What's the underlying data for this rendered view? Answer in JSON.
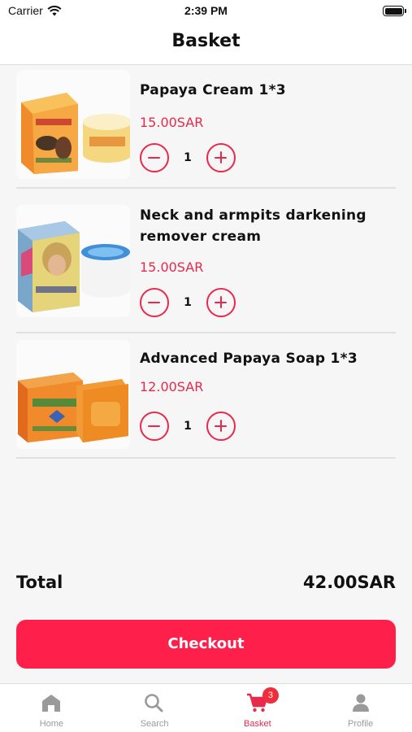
{
  "status_bar": {
    "carrier": "Carrier",
    "time": "2:39 PM"
  },
  "header": {
    "title": "Basket"
  },
  "cart": {
    "items": [
      {
        "name": "Papaya Cream 1*3",
        "price": "15.00SAR",
        "quantity": "1"
      },
      {
        "name": "Neck and armpits darkening remover cream",
        "price": "15.00SAR",
        "quantity": "1"
      },
      {
        "name": "Advanced Papaya Soap 1*3",
        "price": "12.00SAR",
        "quantity": "1"
      }
    ]
  },
  "summary": {
    "total_label": "Total",
    "total_value": "42.00SAR"
  },
  "checkout": {
    "label": "Checkout"
  },
  "tab_bar": {
    "tabs": [
      {
        "label": "Home",
        "icon": "home-icon"
      },
      {
        "label": "Search",
        "icon": "search-icon"
      },
      {
        "label": "Basket",
        "icon": "cart-icon",
        "badge": "3"
      },
      {
        "label": "Profile",
        "icon": "person-icon"
      }
    ],
    "active": "Basket"
  },
  "colors": {
    "accent": "#e8294c",
    "checkout_bg": "#ff1f4b",
    "inactive": "#9a9a9a"
  }
}
